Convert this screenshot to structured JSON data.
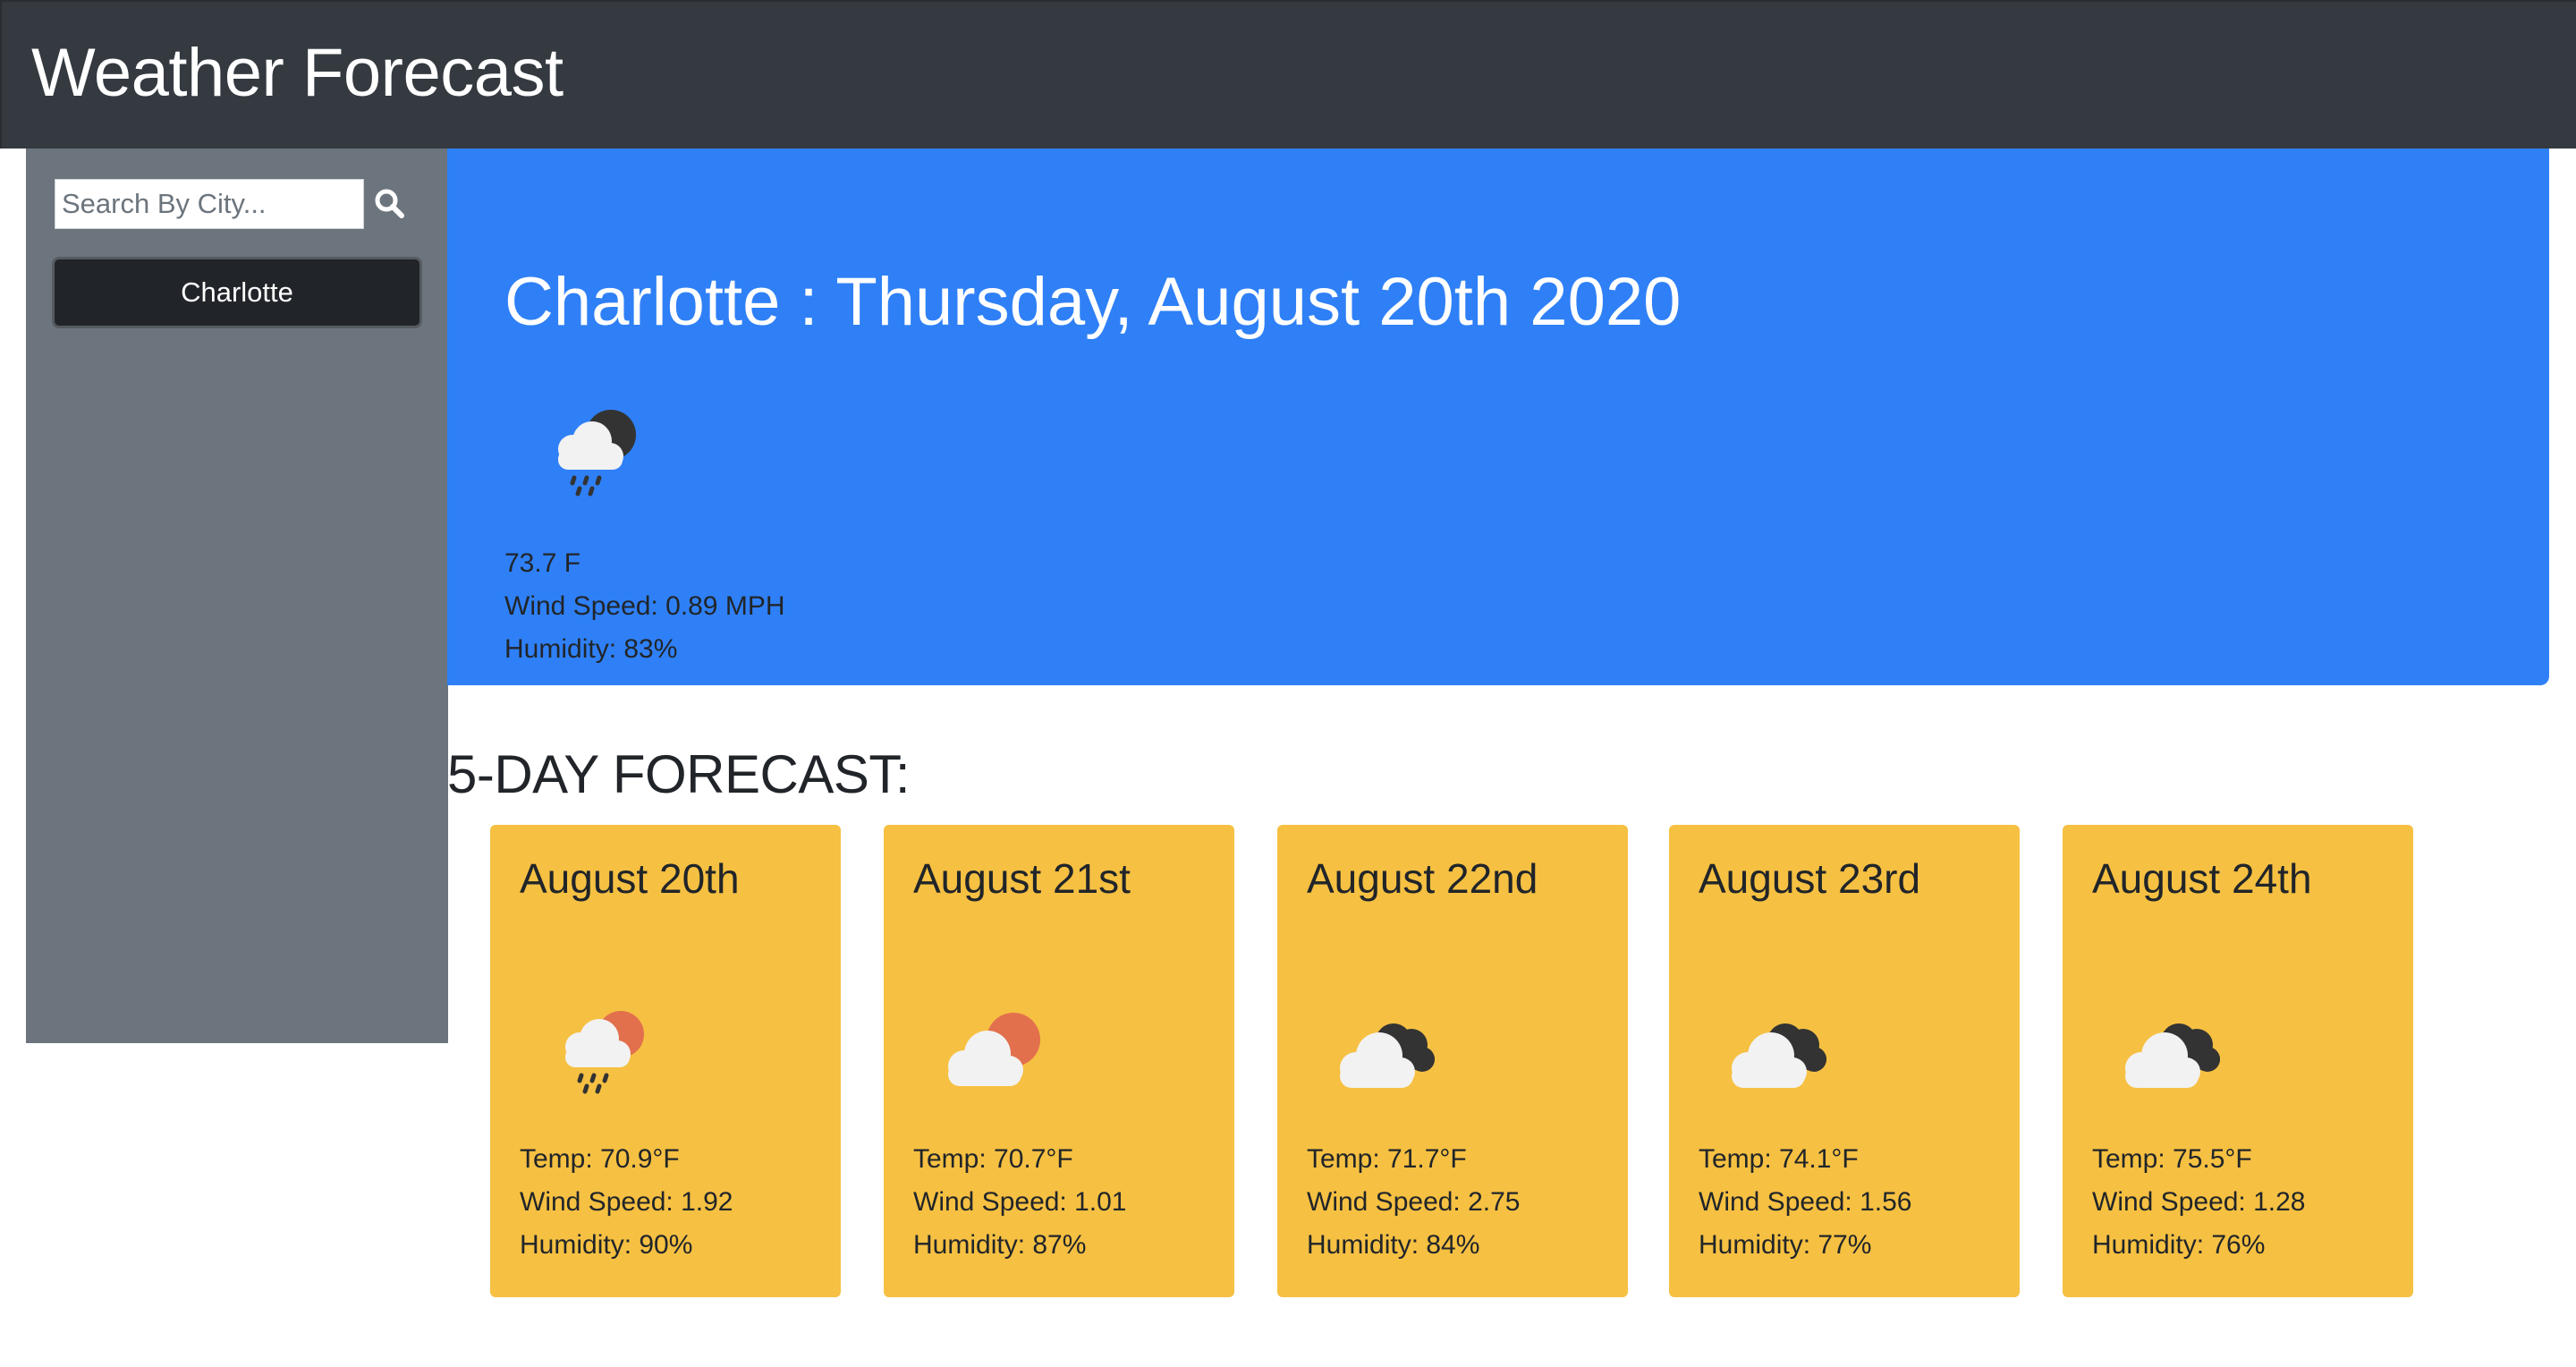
{
  "app": {
    "title": "Weather Forecast"
  },
  "search": {
    "placeholder": "Search By City...",
    "value": "",
    "icon": "search-icon"
  },
  "history": [
    {
      "label": "Charlotte"
    }
  ],
  "current": {
    "title": "Charlotte : Thursday, August 20th 2020",
    "icon": "rain-cloud-night-icon",
    "temp": "73.7 F",
    "wind": "Wind Speed: 0.89 MPH",
    "humidity": "Humidity: 83%"
  },
  "forecast": {
    "heading": "5-DAY FORECAST:",
    "days": [
      {
        "date": "August 20th",
        "icon": "rain-cloud-sun-icon",
        "temp": "Temp: 70.9°F",
        "wind": "Wind Speed: 1.92",
        "humidity": "Humidity: 90%"
      },
      {
        "date": "August 21st",
        "icon": "partly-cloudy-sun-icon",
        "temp": "Temp: 70.7°F",
        "wind": "Wind Speed: 1.01",
        "humidity": "Humidity: 87%"
      },
      {
        "date": "August 22nd",
        "icon": "broken-clouds-icon",
        "temp": "Temp: 71.7°F",
        "wind": "Wind Speed: 2.75",
        "humidity": "Humidity: 84%"
      },
      {
        "date": "August 23rd",
        "icon": "broken-clouds-icon",
        "temp": "Temp: 74.1°F",
        "wind": "Wind Speed: 1.56",
        "humidity": "Humidity: 77%"
      },
      {
        "date": "August 24th",
        "icon": "broken-clouds-icon",
        "temp": "Temp: 75.5°F",
        "wind": "Wind Speed: 1.28",
        "humidity": "Humidity: 76%"
      }
    ]
  },
  "colors": {
    "navbar": "#343a40",
    "sidebar": "#6c757d",
    "current_panel": "#2f80f6",
    "forecast_card": "#f6c042",
    "history_button": "#212529"
  }
}
